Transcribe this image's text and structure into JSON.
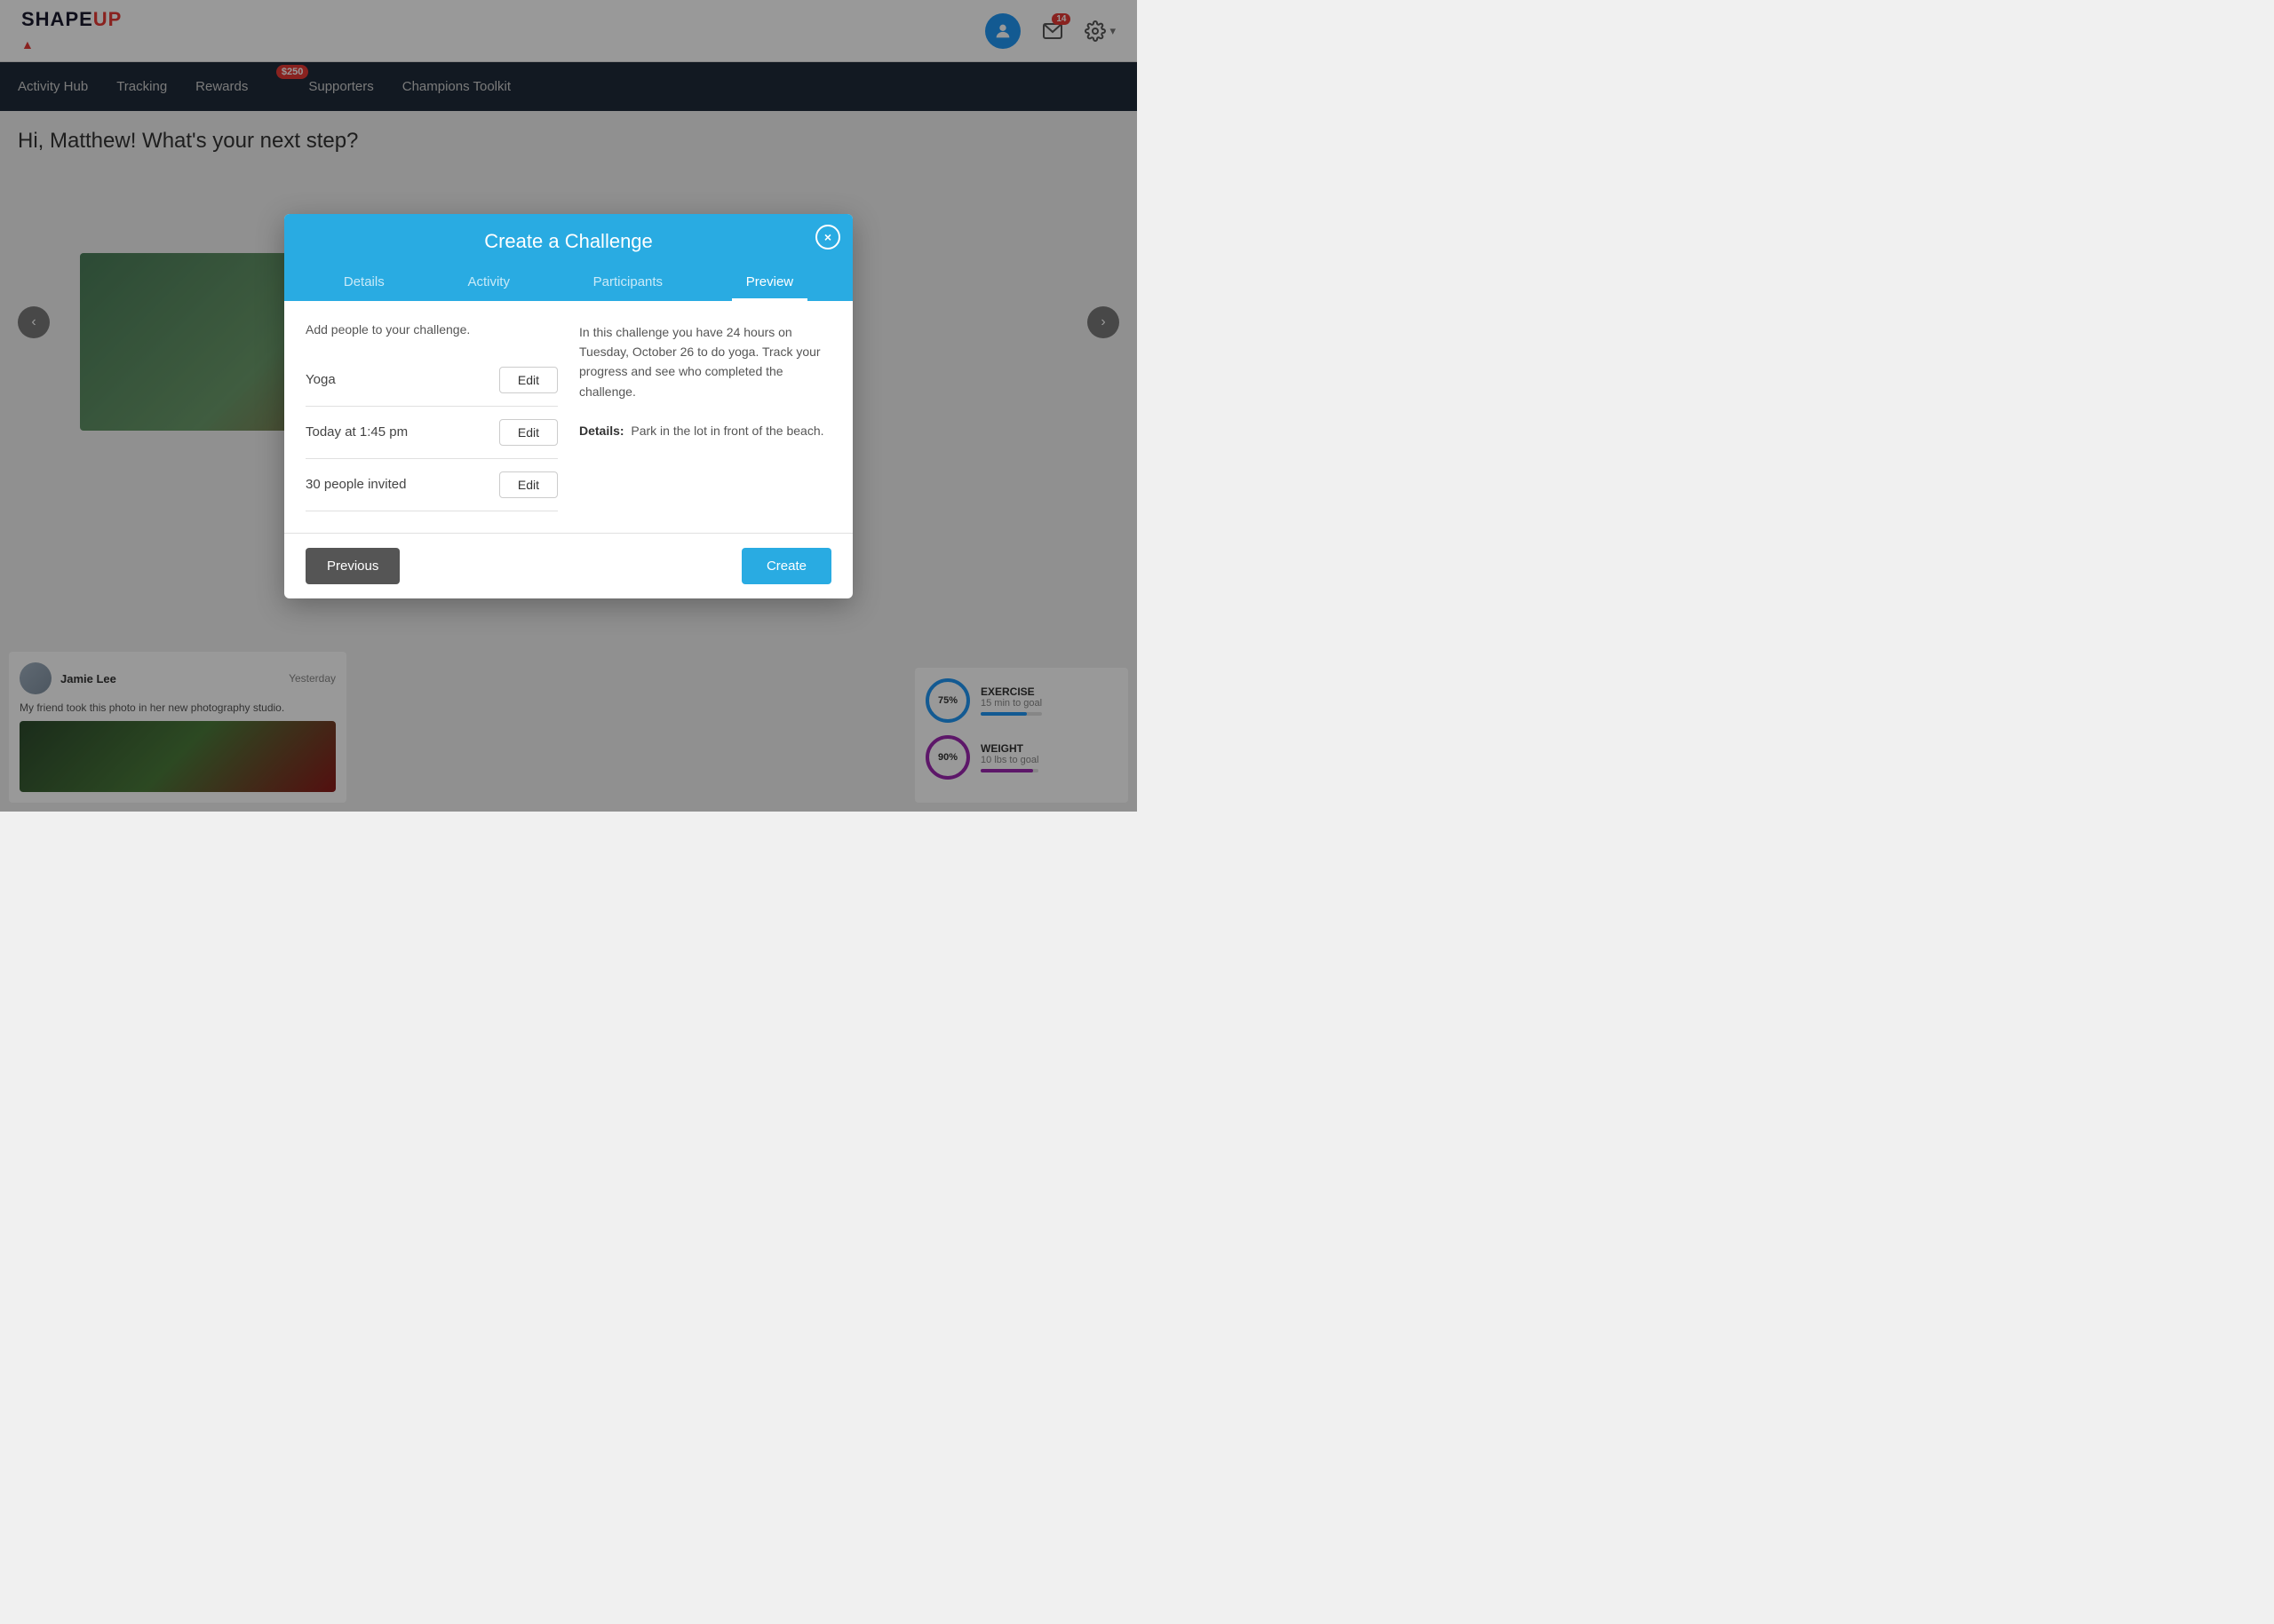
{
  "header": {
    "logo_text": "SHAPEUP",
    "logo_accent": "▲",
    "mail_count": "14",
    "avatar_icon": "👤"
  },
  "nav": {
    "items": [
      {
        "label": "Activity Hub",
        "id": "activity-hub"
      },
      {
        "label": "Tracking",
        "id": "tracking"
      },
      {
        "label": "Rewards",
        "id": "rewards",
        "badge": "$250"
      },
      {
        "label": "Supporters",
        "id": "supporters"
      },
      {
        "label": "Champions Toolkit",
        "id": "champions-toolkit"
      }
    ]
  },
  "page": {
    "greeting": "Hi, Matthew! What's your next step?"
  },
  "social": {
    "user_name": "Jamie Lee",
    "post_time": "Yesterday",
    "post_text": "My friend took this photo in her new photography studio."
  },
  "stats": [
    {
      "id": "exercise",
      "label": "EXERCISE",
      "sub": "15 min to goal",
      "pct": "75%",
      "type": "exercise"
    },
    {
      "id": "weight",
      "label": "WEIGHT",
      "sub": "10 lbs to goal",
      "pct": "90%",
      "type": "weight"
    }
  ],
  "modal": {
    "title": "Create a Challenge",
    "close_label": "×",
    "tabs": [
      {
        "label": "Details",
        "id": "details",
        "active": false
      },
      {
        "label": "Activity",
        "id": "activity",
        "active": false
      },
      {
        "label": "Participants",
        "id": "participants",
        "active": false
      },
      {
        "label": "Preview",
        "id": "preview",
        "active": true
      }
    ],
    "add_people_text": "Add people to your challenge.",
    "rows": [
      {
        "label": "Yoga",
        "edit_label": "Edit"
      },
      {
        "label": "Today at 1:45 pm",
        "edit_label": "Edit"
      },
      {
        "label": "30 people invited",
        "edit_label": "Edit"
      }
    ],
    "preview_text": "In this challenge you have 24 hours on Tuesday, October 26 to do yoga. Track your progress and see who completed the challenge.",
    "details_label": "Details:",
    "details_text": "Park in the lot in front of the beach.",
    "previous_label": "Previous",
    "create_label": "Create"
  }
}
